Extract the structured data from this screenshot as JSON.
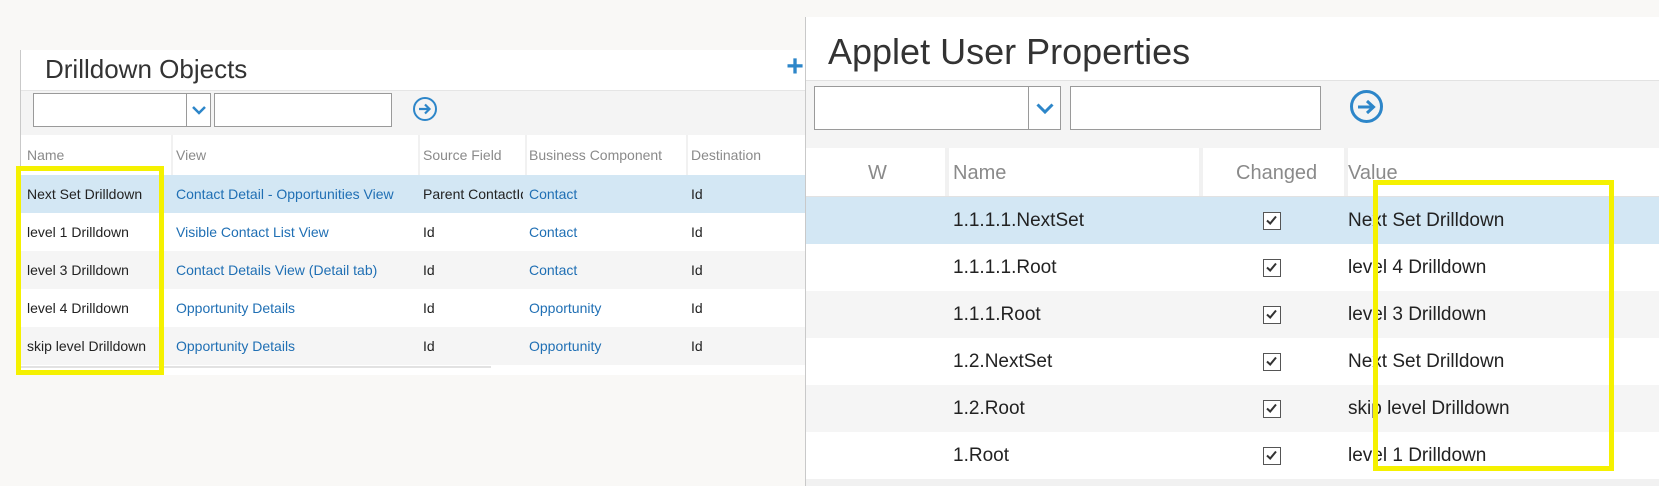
{
  "left": {
    "title": "Drilldown Objects",
    "add_icon": "plus-icon",
    "search_field_value": "",
    "search_value": "",
    "columns": [
      "Name",
      "View",
      "Source Field",
      "Business Component",
      "Destination F"
    ],
    "rows": [
      {
        "name": "Next Set Drilldown",
        "view": "Contact Detail - Opportunities View",
        "source": "Parent ContactId",
        "bc": "Contact",
        "dest": "Id",
        "selected": true
      },
      {
        "name": "level 1 Drilldown",
        "view": "Visible Contact List View",
        "source": "Id",
        "bc": "Contact",
        "dest": "Id"
      },
      {
        "name": "level 3 Drilldown",
        "view": "Contact Details View (Detail tab)",
        "source": "Id",
        "bc": "Contact",
        "dest": "Id"
      },
      {
        "name": "level 4 Drilldown",
        "view": "Opportunity Details",
        "source": "Id",
        "bc": "Opportunity",
        "dest": "Id"
      },
      {
        "name": "skip level Drilldown",
        "view": "Opportunity Details",
        "source": "Id",
        "bc": "Opportunity",
        "dest": "Id"
      }
    ]
  },
  "right": {
    "title": "Applet User Properties",
    "search_field_value": "",
    "search_value": "",
    "columns": [
      "W",
      "Name",
      "Changed",
      "Value"
    ],
    "rows": [
      {
        "name": "1.1.1.1.NextSet",
        "changed": true,
        "value": "Next Set Drilldown",
        "selected": true
      },
      {
        "name": "1.1.1.1.Root",
        "changed": true,
        "value": "level 4 Drilldown"
      },
      {
        "name": "1.1.1.Root",
        "changed": true,
        "value": "level 3 Drilldown"
      },
      {
        "name": "1.2.NextSet",
        "changed": true,
        "value": "Next Set Drilldown"
      },
      {
        "name": "1.2.Root",
        "changed": true,
        "value": "skip level Drilldown"
      },
      {
        "name": "1.Root",
        "changed": true,
        "value": "level 1 Drilldown"
      }
    ]
  },
  "colors": {
    "accent": "#2d86c9",
    "link": "#1f6fb4",
    "selected_row": "#d3e7f4",
    "highlight_box": "#f5f100"
  },
  "icons": {
    "dropdown": "chevron-down-icon",
    "go": "arrow-right-circle-icon",
    "checkbox": "checkbox-checked-icon"
  }
}
